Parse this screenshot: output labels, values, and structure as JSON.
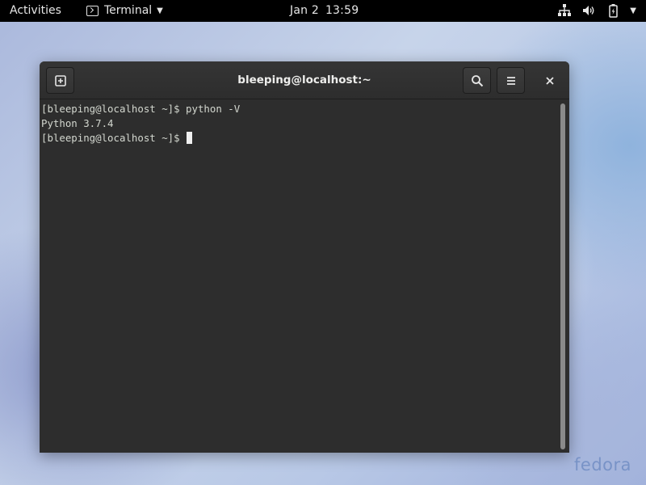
{
  "topbar": {
    "activities": "Activities",
    "app_name": "Terminal",
    "app_icon": "terminal-icon",
    "date": "Jan 2",
    "time": "13:59",
    "tray_icons": [
      "network-icon",
      "volume-icon",
      "battery-icon",
      "system-menu-caret-icon"
    ]
  },
  "window": {
    "title": "bleeping@localhost:~",
    "buttons": [
      "new-tab-icon",
      "search-icon",
      "hamburger-menu-icon",
      "close-icon"
    ]
  },
  "terminal": {
    "lines": [
      "[bleeping@localhost ~]$ python -V",
      "Python 3.7.4",
      "[bleeping@localhost ~]$ "
    ]
  },
  "desktop": {
    "logo_text": "fedora"
  },
  "colors": {
    "topbar_bg": "#000000",
    "terminal_bg": "#2d2d2d",
    "terminal_fg": "#d3d7cf",
    "fedora_logo": "#6a88c0"
  }
}
